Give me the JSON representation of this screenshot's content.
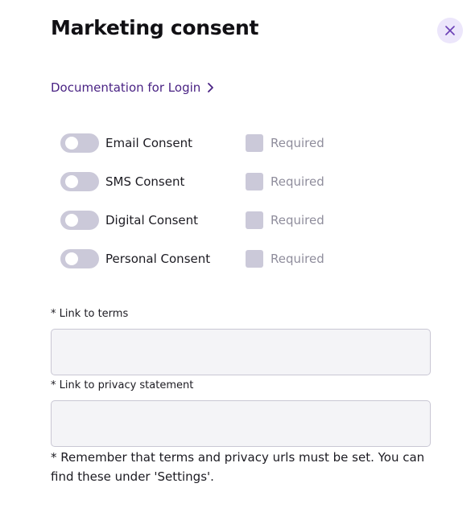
{
  "dialog": {
    "title": "Marketing consent",
    "close_icon": "close-icon",
    "doc_link": "Documentation for Login",
    "doc_link_icon": "chevron-right-icon"
  },
  "consents": [
    {
      "label": "Email Consent",
      "enabled": false,
      "required_label": "Required",
      "required": false
    },
    {
      "label": "SMS Consent",
      "enabled": false,
      "required_label": "Required",
      "required": false
    },
    {
      "label": "Digital Consent",
      "enabled": false,
      "required_label": "Required",
      "required": false
    },
    {
      "label": "Personal Consent",
      "enabled": false,
      "required_label": "Required",
      "required": false
    }
  ],
  "fields": {
    "terms": {
      "label": "* Link to terms",
      "value": "",
      "placeholder": ""
    },
    "privacy": {
      "label": "* Link to privacy statement",
      "value": "",
      "placeholder": ""
    }
  },
  "note": "* Remember that terms and privacy urls must be set. You can find these under 'Settings'.",
  "colors": {
    "accent": "#4a2384",
    "close_bg": "#ece6fb",
    "toggle_off": "#cbc9d9",
    "muted_text": "#8f8d9c",
    "input_bg": "#f4f4f7"
  }
}
